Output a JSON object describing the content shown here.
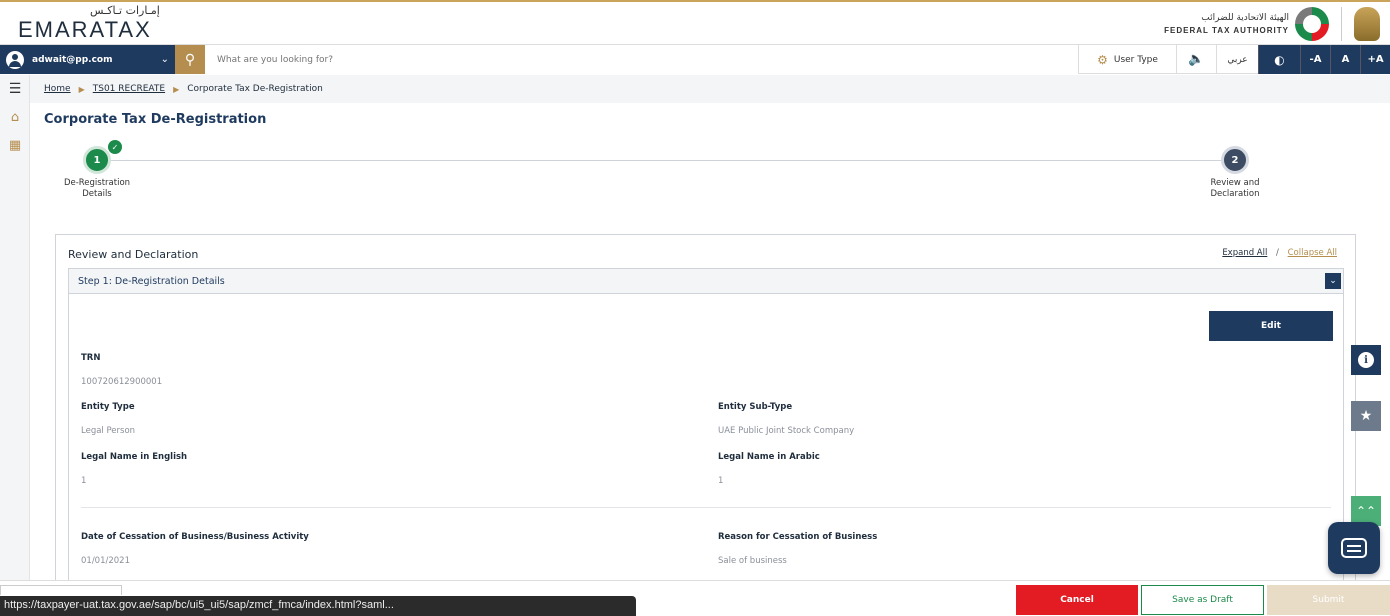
{
  "brand": {
    "logo_arabic": "إمـارات تـاكـس",
    "logo_english": "EMARATAX",
    "authority_arabic": "الهيئة الاتحادية للضرائب",
    "authority_english": "FEDERAL TAX AUTHORITY"
  },
  "toolbar": {
    "user_email": "adwait@pp.com",
    "search_placeholder": "What are you looking for?",
    "user_type_label": "User Type",
    "language_label": "عربي",
    "font_decrease": "-A",
    "font_default": "A",
    "font_increase": "+A",
    "icons": [
      "user-icon",
      "chevron-down-icon",
      "search-icon",
      "gear-icon",
      "speaker-icon",
      "contrast-icon"
    ]
  },
  "breadcrumb": {
    "home": "Home",
    "parent": "TS01 RECREATE",
    "current": "Corporate Tax De-Registration"
  },
  "page": {
    "title": "Corporate Tax De-Registration"
  },
  "stepper": {
    "steps": [
      {
        "number": "1",
        "label_line1": "De-Registration",
        "label_line2": "Details",
        "status": "complete"
      },
      {
        "number": "2",
        "label_line1": "Review and",
        "label_line2": "Declaration",
        "status": "current"
      }
    ]
  },
  "review": {
    "title": "Review and Declaration",
    "expand_all": "Expand All",
    "separator": "/",
    "collapse_all": "Collapse All",
    "section": {
      "title": "Step 1: De-Registration Details",
      "edit_label": "Edit",
      "fields": {
        "trn": {
          "label": "TRN",
          "value": "100720612900001"
        },
        "entity_type": {
          "label": "Entity Type",
          "value": "Legal Person"
        },
        "entity_sub_type": {
          "label": "Entity Sub-Type",
          "value": "UAE Public Joint Stock Company"
        },
        "legal_name_en": {
          "label": "Legal Name in English",
          "value": "1"
        },
        "legal_name_ar": {
          "label": "Legal Name in Arabic",
          "value": "1"
        },
        "cessation_date": {
          "label": "Date of Cessation of Business/Business Activity",
          "value": "01/01/2021"
        },
        "cessation_reason": {
          "label": "Reason for Cessation of Business",
          "value": "Sale of business"
        }
      }
    }
  },
  "footer": {
    "cancel_label": "Cancel",
    "draft_label": "Save as Draft",
    "submit_label": "Submit",
    "status_url": "https://taxpayer-uat.tax.gov.ae/sap/bc/ui5_ui5/sap/zmcf_fmca/index.html?saml..."
  },
  "colors": {
    "primary": "#1f3a5f",
    "gold": "#b58e4f",
    "success": "#1b8a4a",
    "danger": "#e31b23"
  }
}
